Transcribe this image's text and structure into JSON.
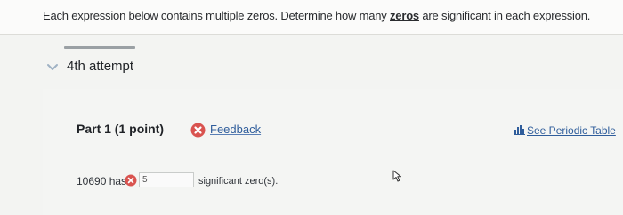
{
  "question": {
    "text_before": "Each expression below contains multiple zeros. Determine how many ",
    "emphasis": "zeros",
    "text_after": " are significant in each expression."
  },
  "attempt": {
    "label": "4th attempt"
  },
  "part": {
    "title": "Part 1  (1 point)",
    "feedback_label": "Feedback",
    "periodic_table_label": "See Periodic Table"
  },
  "expression": {
    "label": "10690 has",
    "input_value": "5",
    "suffix": "significant zero(s)."
  },
  "colors": {
    "error_red": "#d9534f",
    "link_blue": "#2f5d9b",
    "chevron": "#9fb2c4"
  },
  "icons": {
    "attempt_toggle": "chevron-down-icon",
    "feedback": "error-x-icon",
    "periodic_table": "bar-chart-icon",
    "answer_status": "error-x-icon",
    "pointer": "mouse-cursor-icon"
  }
}
